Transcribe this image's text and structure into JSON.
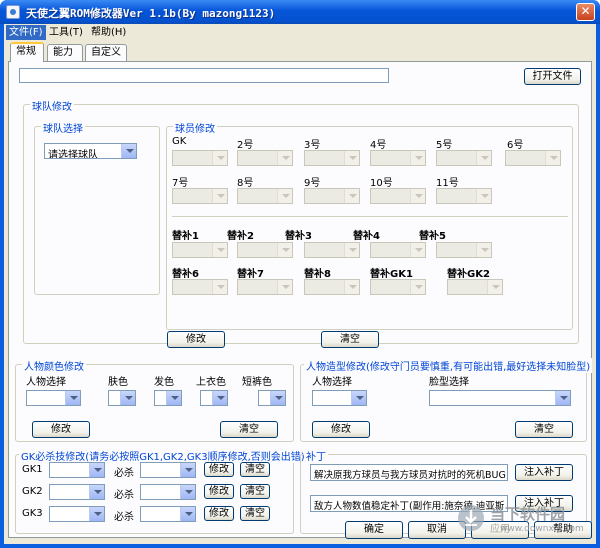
{
  "window": {
    "title": "天使之翼ROM修改器Ver 1.1b(By mazong1123)",
    "close": "✕"
  },
  "menu": [
    "文件(F)",
    "工具(T)",
    "帮助(H)"
  ],
  "tabs": [
    "常规",
    "能力",
    "自定义"
  ],
  "top": {
    "path_value": "",
    "open_button": "打开文件"
  },
  "team": {
    "legend": "球队修改",
    "select_legend": "球队选择",
    "team_combo": "请选择球队",
    "players_legend": "球员修改",
    "row1": [
      "GK",
      "2号",
      "3号",
      "4号",
      "5号",
      "6号"
    ],
    "row2": [
      "7号",
      "8号",
      "9号",
      "10号",
      "11号"
    ],
    "subs1": [
      "替补1",
      "替补2",
      "替补3",
      "替补4",
      "替补5"
    ],
    "subs2": [
      "替补6",
      "替补7",
      "替补8",
      "替补GK1",
      "替补GK2"
    ],
    "modify": "修改",
    "clear": "清空"
  },
  "color": {
    "legend": "人物颜色修改",
    "labels": [
      "人物选择",
      "肤色",
      "发色",
      "上衣色",
      "短裤色"
    ],
    "modify": "修改",
    "clear": "清空"
  },
  "shape": {
    "legend": "人物造型修改(修改守门员要慎重,有可能出错,最好选择未知脸型)",
    "person_label": "人物选择",
    "face_label": "脸型选择",
    "modify": "修改",
    "clear": "清空"
  },
  "gk": {
    "legend": "GK必杀技修改(请务必按照GK1,GK2,GK3顺序修改,否则会出错)",
    "rows": [
      "GK1",
      "GK2",
      "GK3"
    ],
    "kill_label": "必杀",
    "modify": "修改",
    "clear": "清空"
  },
  "patch": {
    "legend": "补丁",
    "items": [
      {
        "text": "解决原我方球员与我方球员对抗时的死机BUG",
        "button": "注入补丁"
      },
      {
        "text": "敌方人物数值稳定补丁(副作用:施奈德,迪亚斯",
        "button": "注入补丁"
      }
    ]
  },
  "footer": {
    "ok": "确定",
    "cancel": "取消",
    "apply": "应用",
    "help": "帮助"
  },
  "watermark": {
    "name": "当下软件园",
    "url": "www.downxia.com"
  }
}
